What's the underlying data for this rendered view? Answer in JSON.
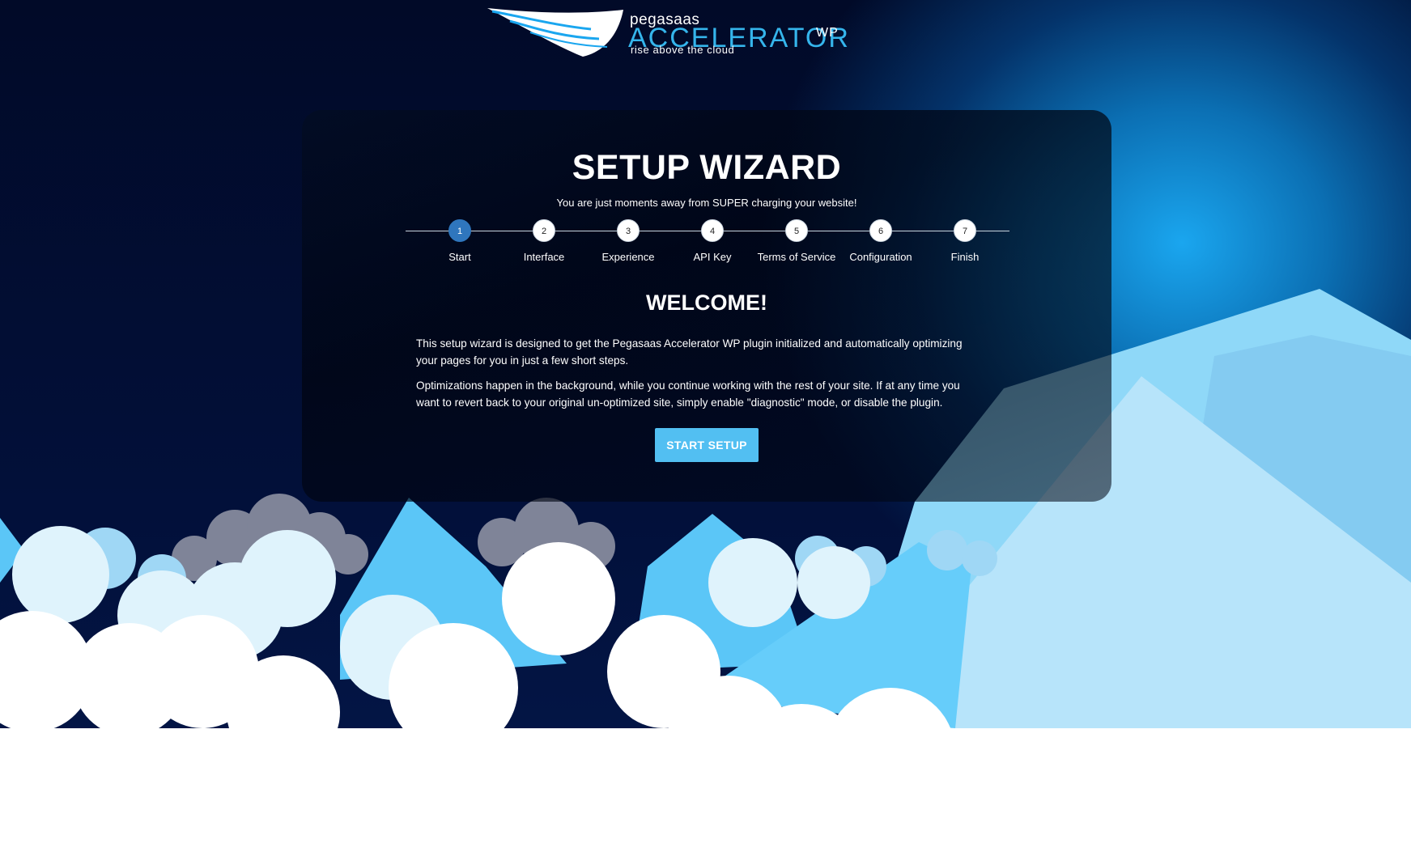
{
  "logo": {
    "brand_small": "pegasaas",
    "brand_big": "ACCELERATOR",
    "brand_suffix": "WP",
    "tagline": "rise above the cloud"
  },
  "wizard": {
    "title": "SETUP WIZARD",
    "subtitle": "You are just moments away from SUPER charging your website!",
    "active_step": 1,
    "steps": [
      {
        "number": "1",
        "label": "Start"
      },
      {
        "number": "2",
        "label": "Interface"
      },
      {
        "number": "3",
        "label": "Experience"
      },
      {
        "number": "4",
        "label": "API Key"
      },
      {
        "number": "5",
        "label": "Terms of Service"
      },
      {
        "number": "6",
        "label": "Configuration"
      },
      {
        "number": "7",
        "label": "Finish"
      }
    ]
  },
  "welcome": {
    "heading": "WELCOME!",
    "paragraph_1": "This setup wizard is designed to get the Pegasaas Accelerator WP plugin initialized and automatically optimizing your pages for you in just a few short steps.",
    "paragraph_2": "Optimizations happen in the background, while you continue working with the rest of your site. If at any time you want to revert back to your original un-optimized site, simply enable \"diagnostic\" mode, or disable the plugin.",
    "button_label": "START SETUP"
  },
  "colors": {
    "accent": "#52bff2",
    "active_step": "#2f76bd",
    "brand_blue": "#35b5ec"
  }
}
